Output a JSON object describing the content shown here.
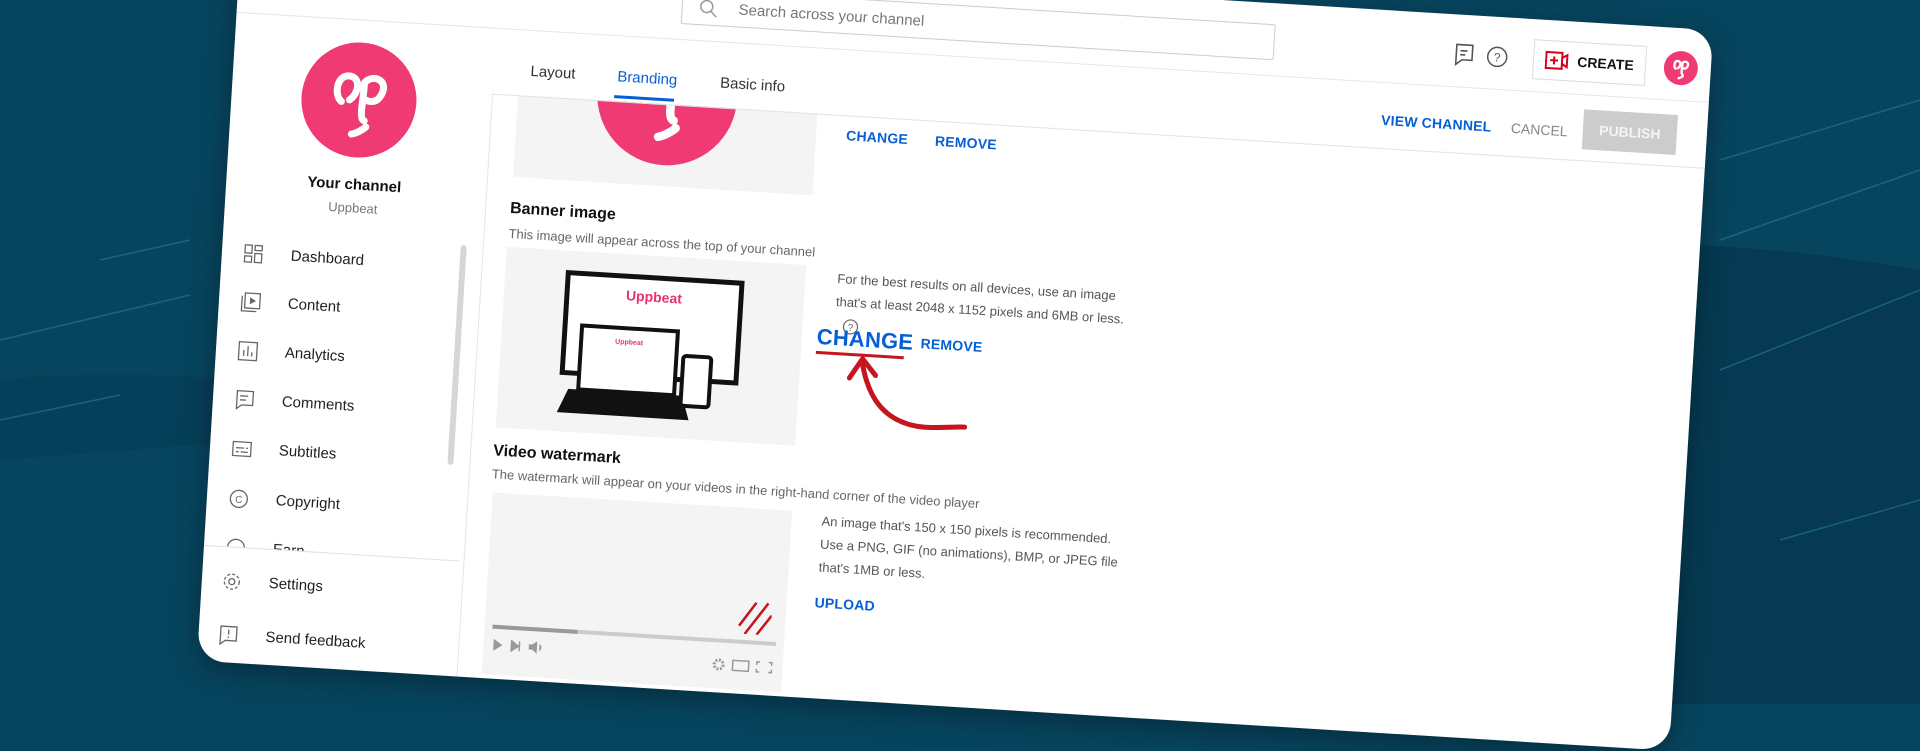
{
  "colors": {
    "background": "#07455f",
    "accent": "#065fd4",
    "brand": "#ef3a73",
    "annotation": "#c8141e",
    "disabled": "#cccccc"
  },
  "header": {
    "search_placeholder": "Search across your channel",
    "icons": [
      "search-icon",
      "feedback-icon",
      "help-icon",
      "create-video-icon",
      "avatar"
    ],
    "create_label": "CREATE"
  },
  "sidebar": {
    "channel_title": "Your channel",
    "channel_name": "Uppbeat",
    "items": [
      {
        "label": "Dashboard",
        "icon": "dashboard-icon"
      },
      {
        "label": "Content",
        "icon": "content-icon"
      },
      {
        "label": "Analytics",
        "icon": "analytics-icon"
      },
      {
        "label": "Comments",
        "icon": "comments-icon"
      },
      {
        "label": "Subtitles",
        "icon": "subtitles-icon"
      },
      {
        "label": "Copyright",
        "icon": "copyright-icon"
      },
      {
        "label": "Earn",
        "icon": "earn-icon"
      }
    ],
    "footer": [
      {
        "label": "Settings",
        "icon": "gear-icon"
      },
      {
        "label": "Send feedback",
        "icon": "send-feedback-icon"
      }
    ]
  },
  "tabs": [
    {
      "label": "Layout"
    },
    {
      "label": "Branding",
      "active": true
    },
    {
      "label": "Basic info"
    }
  ],
  "actions": {
    "view_channel": "VIEW CHANNEL",
    "cancel": "CANCEL",
    "publish": "PUBLISH"
  },
  "picture": {
    "change": "CHANGE",
    "remove": "REMOVE"
  },
  "banner": {
    "title": "Banner image",
    "subtitle": "This image will appear across the top of your channel",
    "description": "For the best results on all devices, use an image that's at least 2048 x 1152 pixels and 6MB or less.",
    "change": "CHANGE",
    "remove": "REMOVE",
    "logo_text": "Uppbeat"
  },
  "watermark": {
    "title": "Video watermark",
    "subtitle": "The watermark will appear on your videos in the right-hand corner of the video player",
    "description": "An image that's 150 x 150 pixels is recommended. Use a PNG, GIF (no animations), BMP, or JPEG file that's 1MB or less.",
    "upload": "UPLOAD",
    "player_progress": 0.3
  }
}
